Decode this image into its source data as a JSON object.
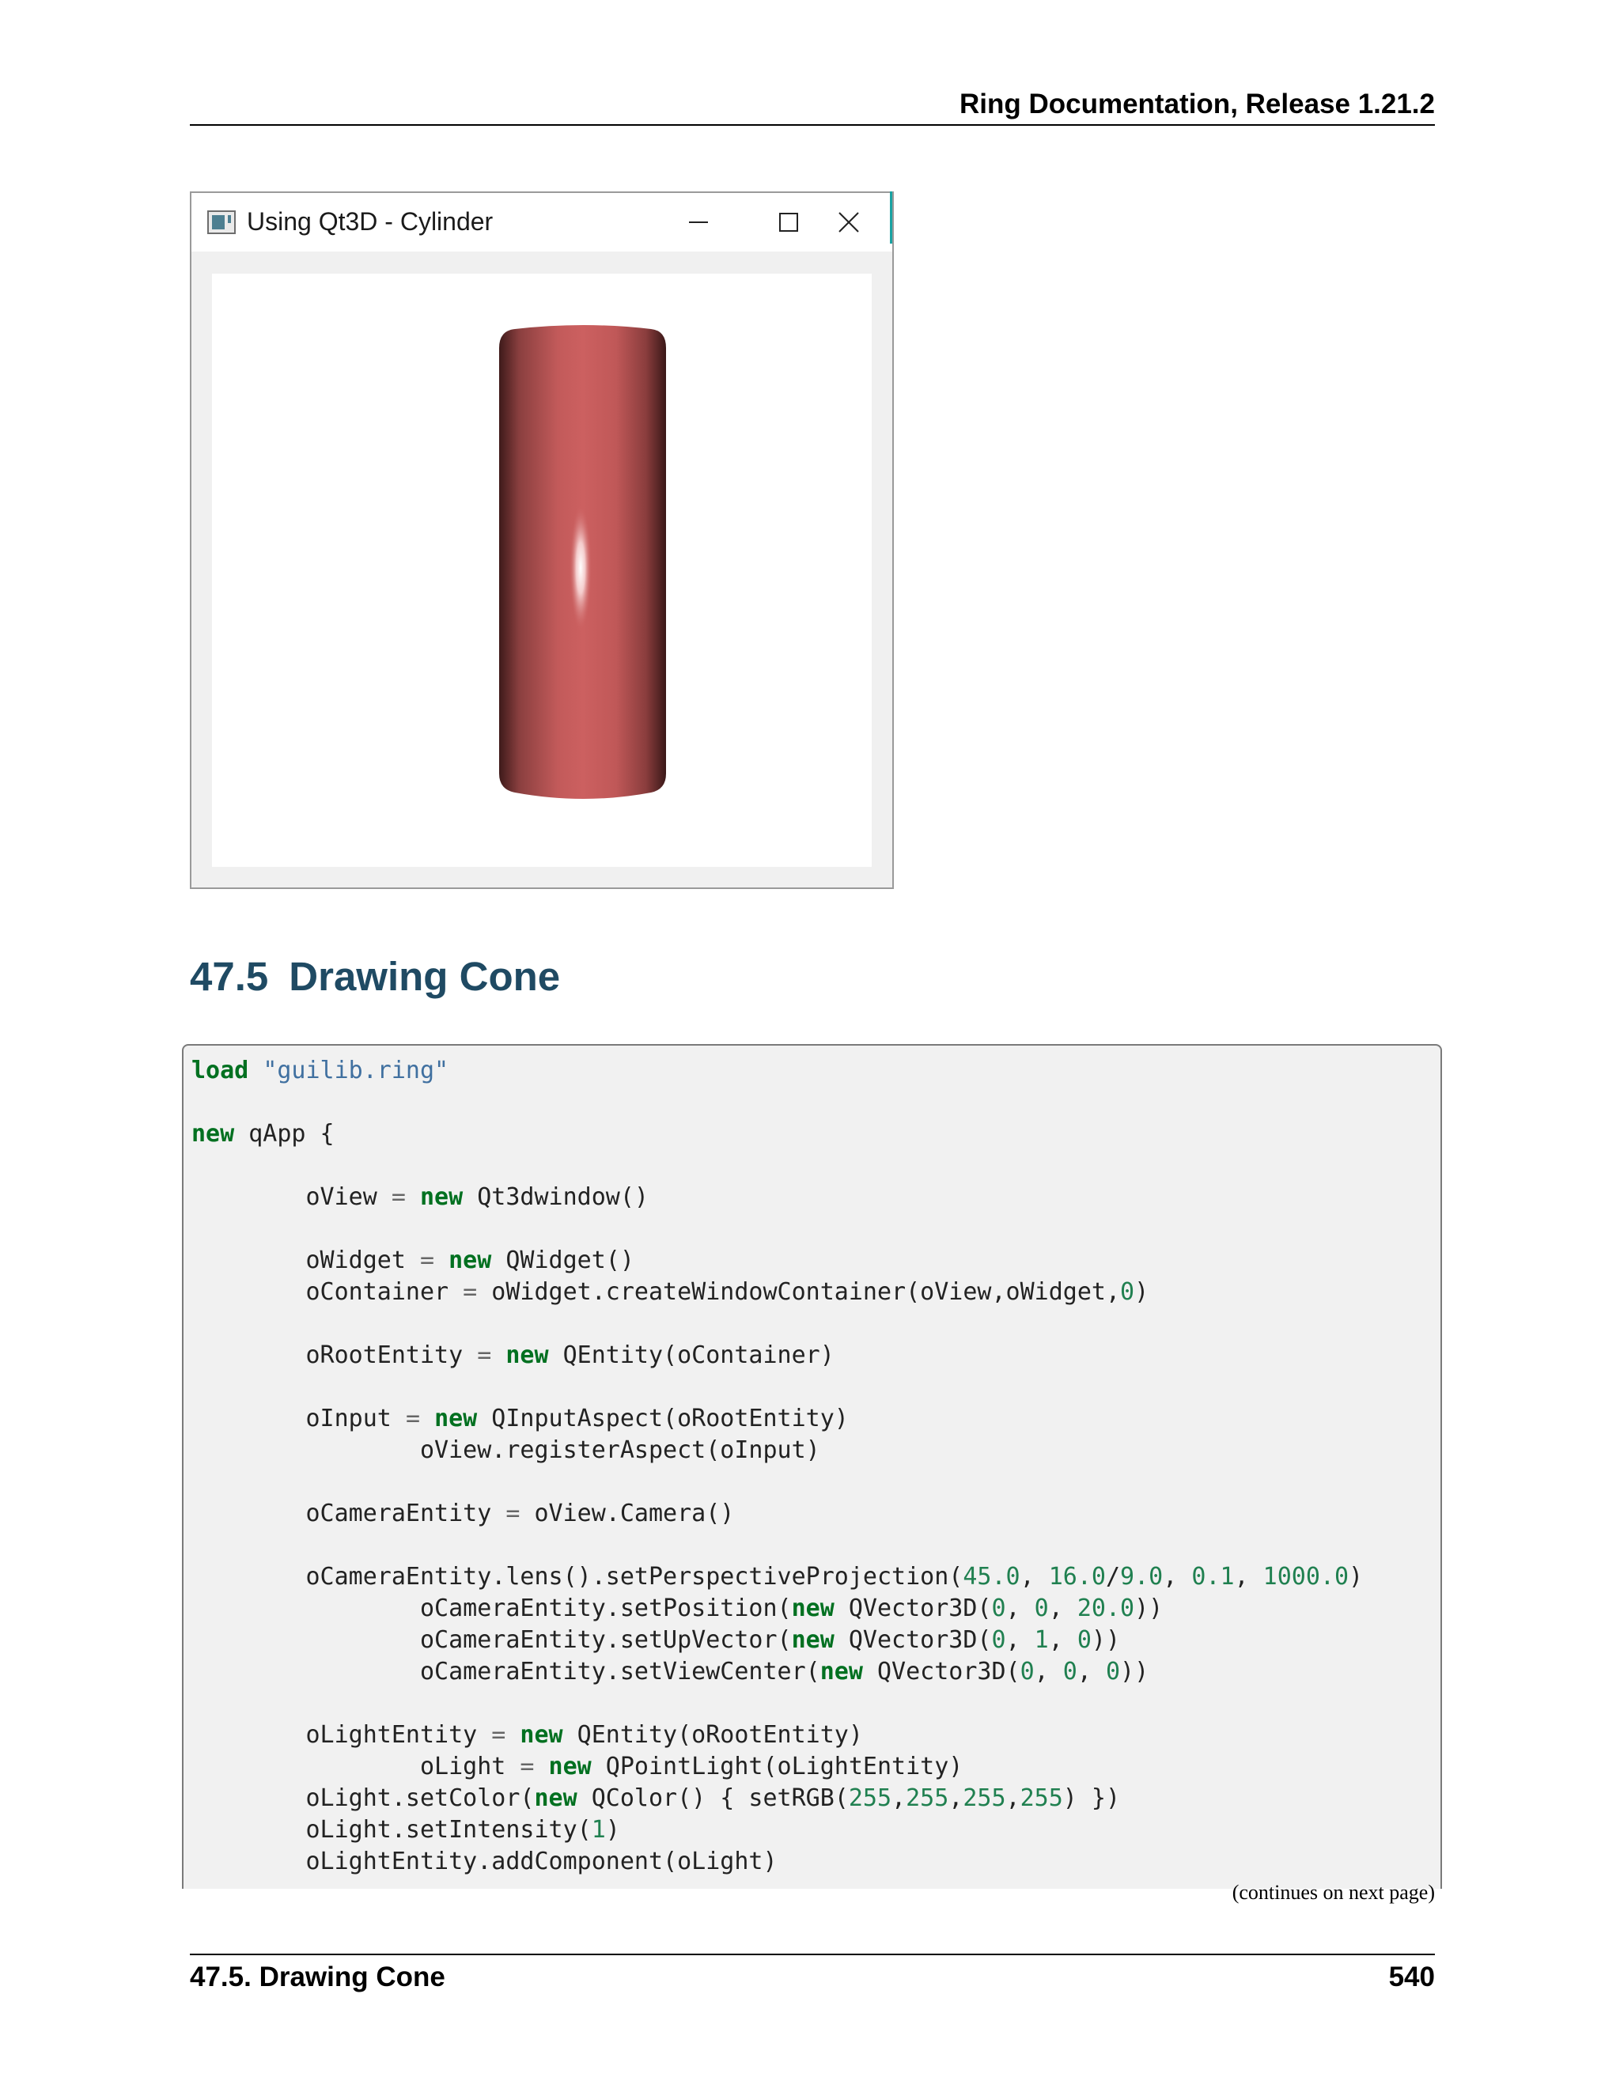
{
  "header": {
    "title": "Ring Documentation, Release 1.21.2"
  },
  "window": {
    "title": "Using Qt3D - Cylinder",
    "cylinder_color": "#cc6060"
  },
  "section": {
    "number": "47.5",
    "title": "Drawing Cone"
  },
  "code": {
    "lines": [
      "load \"guilib.ring\"",
      "",
      "new qApp {",
      "",
      "        oView = new Qt3dwindow()",
      "",
      "        oWidget = new QWidget()",
      "        oContainer = oWidget.createWindowContainer(oView,oWidget,0)",
      "",
      "        oRootEntity = new QEntity(oContainer)",
      "",
      "        oInput = new QInputAspect(oRootEntity)",
      "                oView.registerAspect(oInput)",
      "",
      "        oCameraEntity = oView.Camera()",
      "",
      "        oCameraEntity.lens().setPerspectiveProjection(45.0, 16.0/9.0, 0.1, 1000.0)",
      "                oCameraEntity.setPosition(new QVector3D(0, 0, 20.0))",
      "                oCameraEntity.setUpVector(new QVector3D(0, 1, 0))",
      "                oCameraEntity.setViewCenter(new QVector3D(0, 0, 0))",
      "",
      "        oLightEntity = new QEntity(oRootEntity)",
      "                oLight = new QPointLight(oLightEntity)",
      "        oLight.setColor(new QColor() { setRGB(255,255,255,255) })",
      "        oLight.setIntensity(1)",
      "        oLightEntity.addComponent(oLight)"
    ]
  },
  "continues": "(continues on next page)",
  "footer": {
    "section": "47.5.  Drawing Cone",
    "page": "540"
  }
}
